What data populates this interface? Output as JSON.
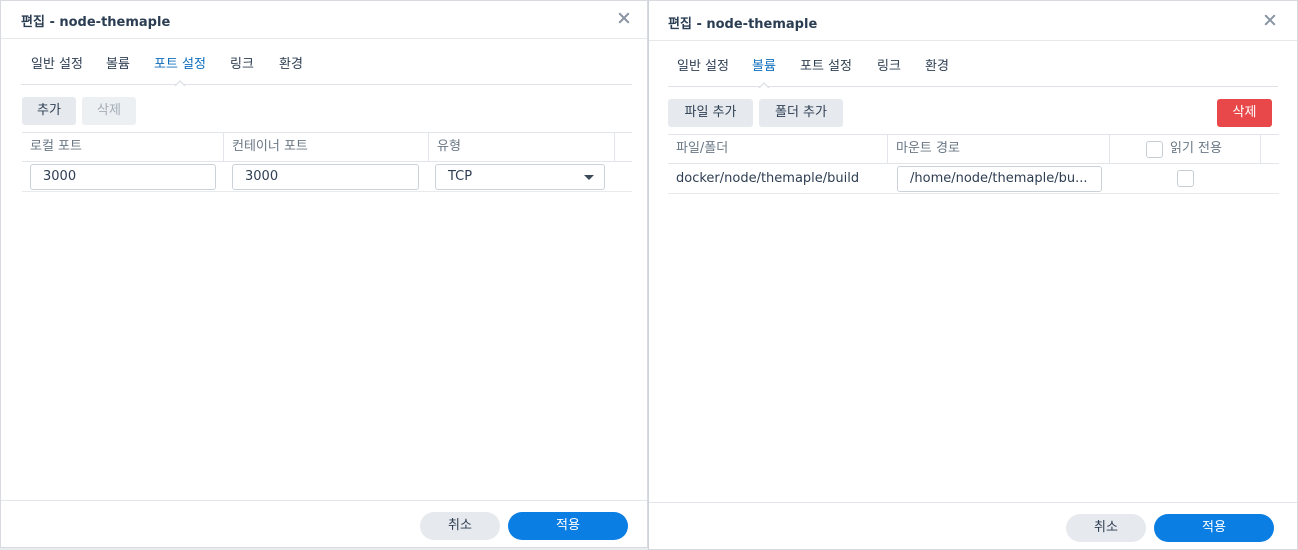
{
  "port_dialog": {
    "title": "편집 - node-themaple",
    "tabs": [
      {
        "label": "일반 설정",
        "active": false
      },
      {
        "label": "볼륨",
        "active": false
      },
      {
        "label": "포트 설정",
        "active": true
      },
      {
        "label": "링크",
        "active": false
      },
      {
        "label": "환경",
        "active": false
      }
    ],
    "toolbar": {
      "add_label": "추가",
      "delete_label": "삭제"
    },
    "columns": [
      "로컬 포트",
      "컨테이너 포트",
      "유형"
    ],
    "rows": [
      {
        "local_port": "3000",
        "container_port": "3000",
        "type": "TCP"
      }
    ],
    "footer": {
      "cancel_label": "취소",
      "apply_label": "적용"
    }
  },
  "volume_dialog": {
    "title": "편집 - node-themaple",
    "tabs": [
      {
        "label": "일반 설정",
        "active": false
      },
      {
        "label": "볼륨",
        "active": true
      },
      {
        "label": "포트 설정",
        "active": false
      },
      {
        "label": "링크",
        "active": false
      },
      {
        "label": "환경",
        "active": false
      }
    ],
    "toolbar": {
      "add_file_label": "파일 추가",
      "add_folder_label": "폴더 추가",
      "delete_label": "삭제"
    },
    "columns": [
      "파일/폴더",
      "마운트 경로",
      "읽기 전용"
    ],
    "rows": [
      {
        "file_folder": "docker/node/themaple/build",
        "mount_path": "/home/node/themaple/bu...",
        "read_only": false
      }
    ],
    "footer": {
      "cancel_label": "취소",
      "apply_label": "적용"
    }
  },
  "colors": {
    "accent": "#0b7ee3",
    "danger": "#e8484a",
    "active_tab": "#0f6ebd"
  }
}
